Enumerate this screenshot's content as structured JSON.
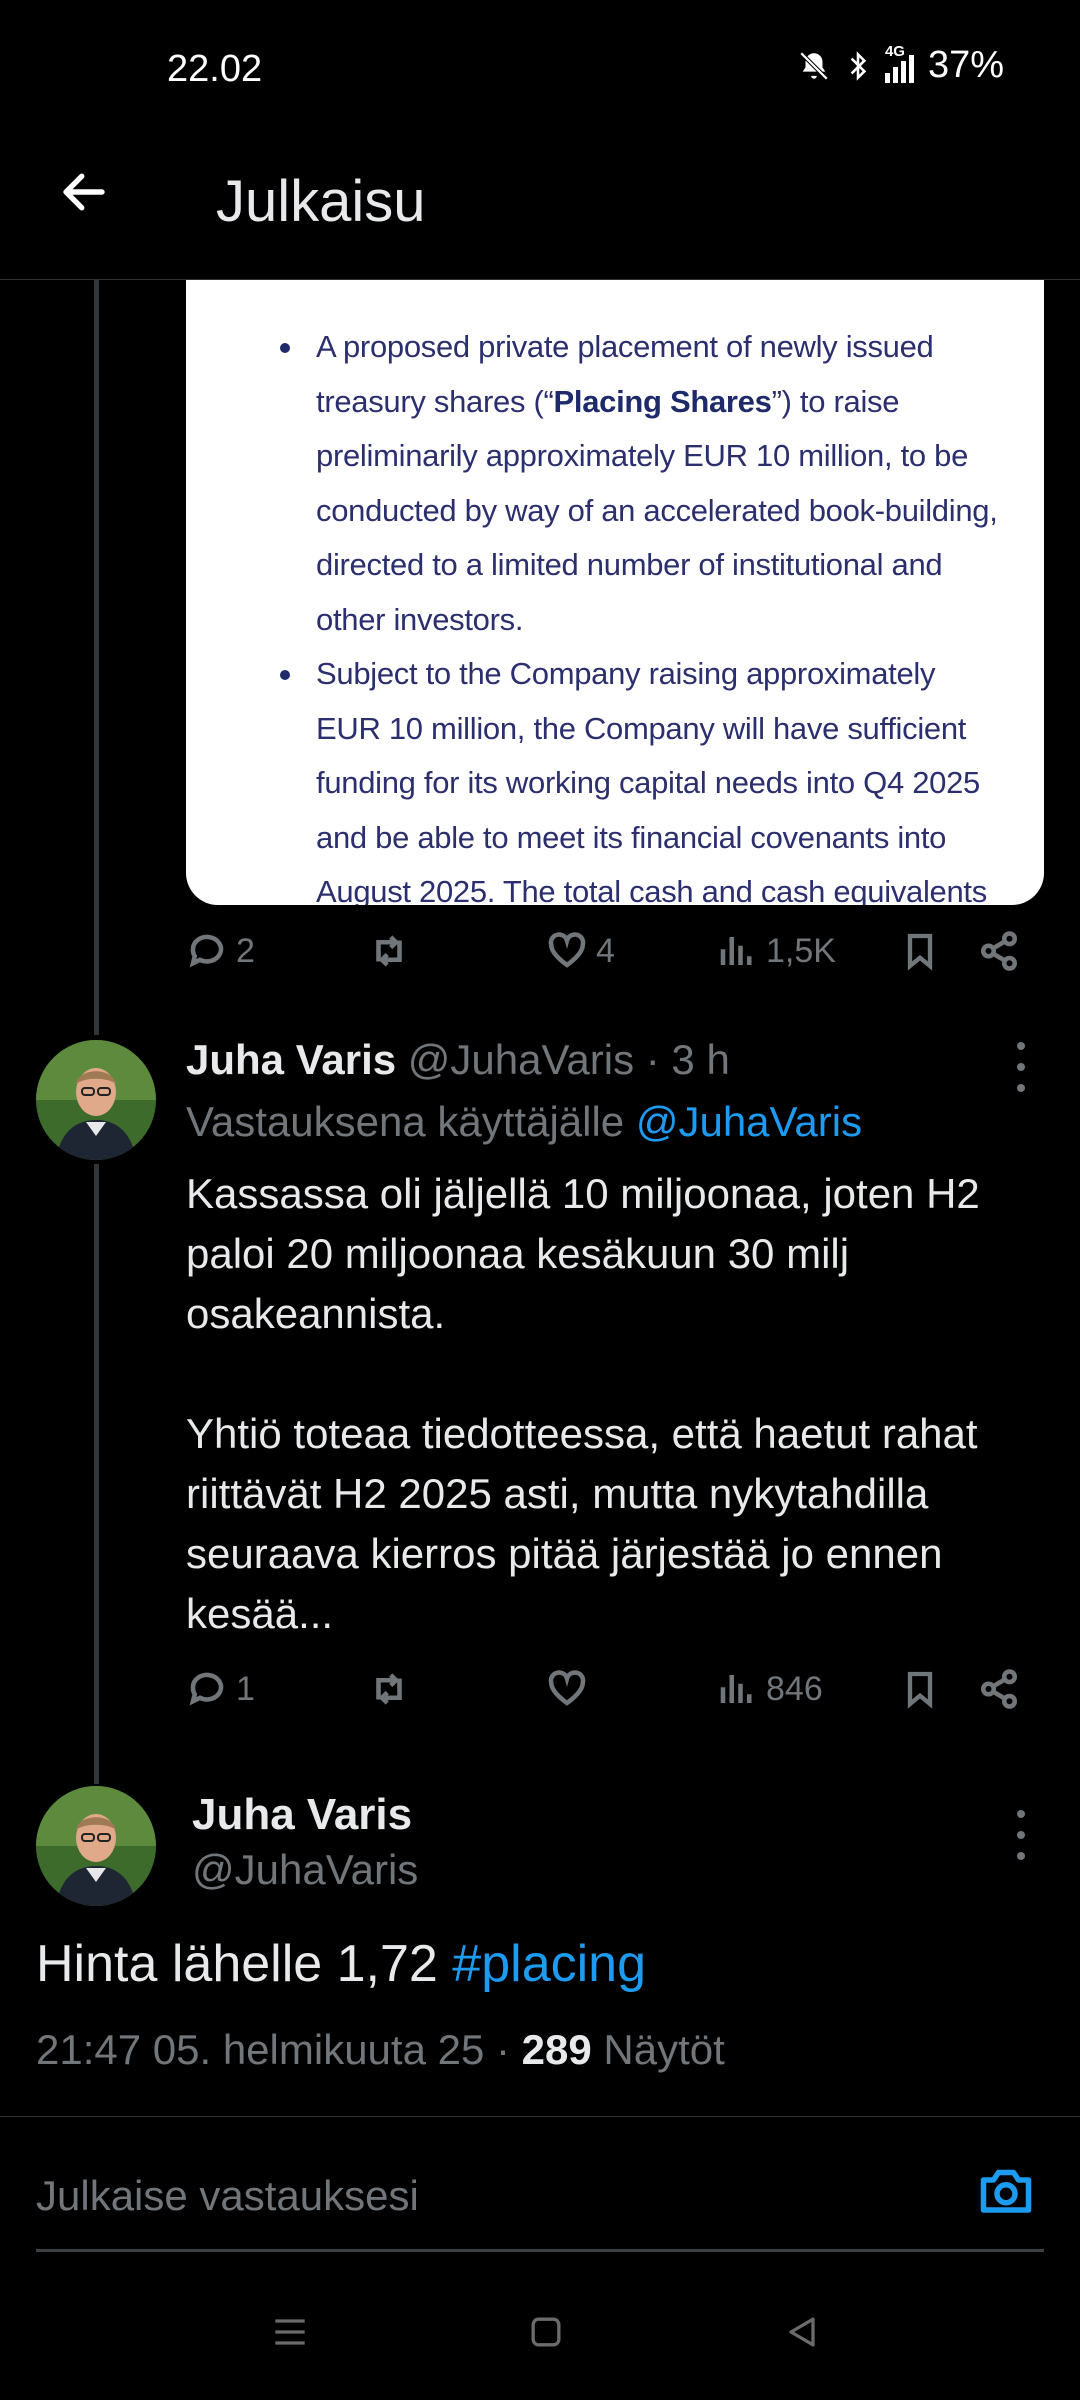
{
  "status_bar": {
    "time": "22.02",
    "network": "4G",
    "battery": "37%"
  },
  "header": {
    "title": "Julkaisu"
  },
  "quoted_image": {
    "bullet1_pre": "A proposed private placement of newly issued treasury shares (“",
    "bullet1_bold": "Placing Shares",
    "bullet1_post": "”) to raise preliminarily approximately EUR 10 million, to be conducted by way of an accelerated book-building, directed to a limited number of institutional and other investors.",
    "bullet2": "Subject to the Company raising approximately EUR 10 million, the Company will have sufficient funding for its working capital needs into Q4 2025 and be able to meet its financial covenants into August 2025. The total cash and cash equivalents"
  },
  "post1_actions": {
    "replies": "2",
    "reposts": "",
    "likes": "4",
    "views": "1,5K"
  },
  "reply": {
    "name": "Juha Varis",
    "handle": "@JuhaVaris",
    "time": "· 3 h",
    "reply_to_label": "Vastauksena käyttäjälle",
    "reply_to_handle": "@JuhaVaris",
    "text": "Kassassa oli jäljellä 10 miljoonaa, joten H2 paloi 20 miljoonaa kesäkuun 30 milj osakeannista.\n\nYhtiö toteaa tiedotteessa, että haetut rahat riittävät H2 2025 asti, mutta nykytahdilla seuraava kierros pitää järjestää jo ennen kesää...",
    "actions": {
      "replies": "1",
      "reposts": "",
      "likes": "",
      "views": "846"
    }
  },
  "main_post": {
    "name": "Juha Varis",
    "handle": "@JuhaVaris",
    "text": "Hinta lähelle 1,72",
    "hashtag": "#placing",
    "timestamp": "21:47 05. helmikuuta 25 ·",
    "views_count": "289",
    "views_label": "Näytöt"
  },
  "compose": {
    "placeholder": "Julkaise vastauksesi"
  },
  "colors": {
    "background": "#000000",
    "accent": "#1d9bf0",
    "muted": "#71767b",
    "text": "#e7e9ea"
  }
}
